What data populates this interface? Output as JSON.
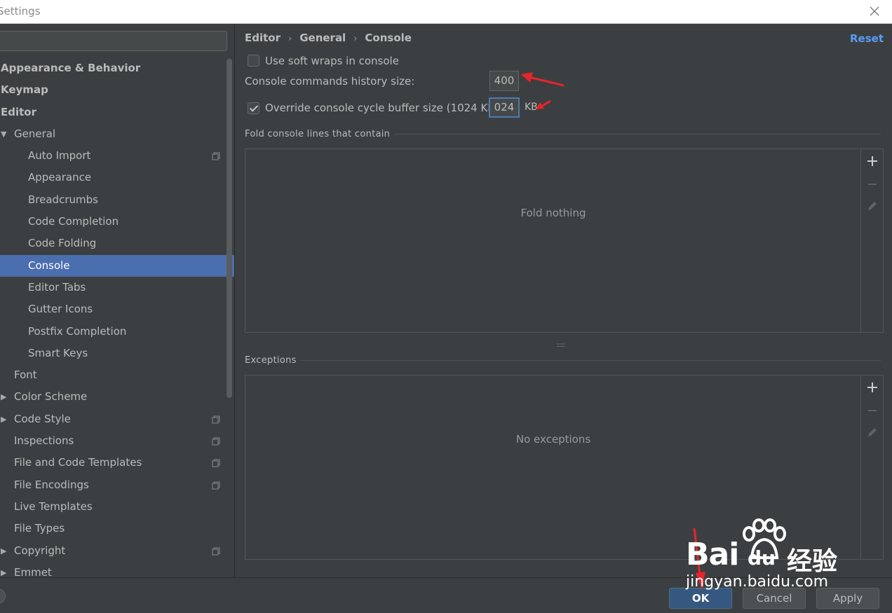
{
  "window": {
    "title": "Settings"
  },
  "sidebar": {
    "items": [
      {
        "label": "Appearance & Behavior",
        "level": 0,
        "bold": true
      },
      {
        "label": "Keymap",
        "level": 0,
        "bold": true
      },
      {
        "label": "Editor",
        "level": 0,
        "bold": true
      },
      {
        "label": "General",
        "level": 1,
        "arrow": "expanded"
      },
      {
        "label": "Auto Import",
        "level": 2,
        "project": true
      },
      {
        "label": "Appearance",
        "level": 2
      },
      {
        "label": "Breadcrumbs",
        "level": 2
      },
      {
        "label": "Code Completion",
        "level": 2
      },
      {
        "label": "Code Folding",
        "level": 2
      },
      {
        "label": "Console",
        "level": 2,
        "selected": true
      },
      {
        "label": "Editor Tabs",
        "level": 2
      },
      {
        "label": "Gutter Icons",
        "level": 2
      },
      {
        "label": "Postfix Completion",
        "level": 2
      },
      {
        "label": "Smart Keys",
        "level": 2
      },
      {
        "label": "Font",
        "level": 1
      },
      {
        "label": "Color Scheme",
        "level": 1,
        "arrow": "collapsed"
      },
      {
        "label": "Code Style",
        "level": 1,
        "arrow": "collapsed",
        "project": true
      },
      {
        "label": "Inspections",
        "level": 1,
        "project": true
      },
      {
        "label": "File and Code Templates",
        "level": 1,
        "project": true
      },
      {
        "label": "File Encodings",
        "level": 1,
        "project": true
      },
      {
        "label": "Live Templates",
        "level": 1
      },
      {
        "label": "File Types",
        "level": 1
      },
      {
        "label": "Copyright",
        "level": 1,
        "arrow": "collapsed",
        "project": true
      },
      {
        "label": "Emmet",
        "level": 1,
        "arrow": "collapsed"
      }
    ]
  },
  "breadcrumb": {
    "part1": "Editor",
    "part2": "General",
    "part3": "Console",
    "separator": "›"
  },
  "reset_label": "Reset",
  "settings": {
    "soft_wraps_label": "Use soft wraps in console",
    "soft_wraps_checked": false,
    "history_label": "Console commands history size:",
    "history_value": "400",
    "override_label": "Override console cycle buffer size (1024 KB)",
    "override_checked": true,
    "buffer_value": "024",
    "buffer_unit": "KB"
  },
  "fold_section": {
    "title": "Fold console lines that contain",
    "empty_text": "Fold nothing"
  },
  "exceptions_section": {
    "title": "Exceptions",
    "empty_text": "No exceptions"
  },
  "splitter_glyph": "::::::",
  "buttons": {
    "ok": "OK",
    "cancel": "Cancel",
    "apply": "Apply"
  },
  "watermark": {
    "brand": "Bai",
    "brand2": "du",
    "cn": "经验",
    "url": "jingyan.baidu.com"
  },
  "colors": {
    "accent": "#589df6",
    "selection": "#4b6eaf",
    "annotation": "#e8242b",
    "background": "#3c3f41"
  }
}
